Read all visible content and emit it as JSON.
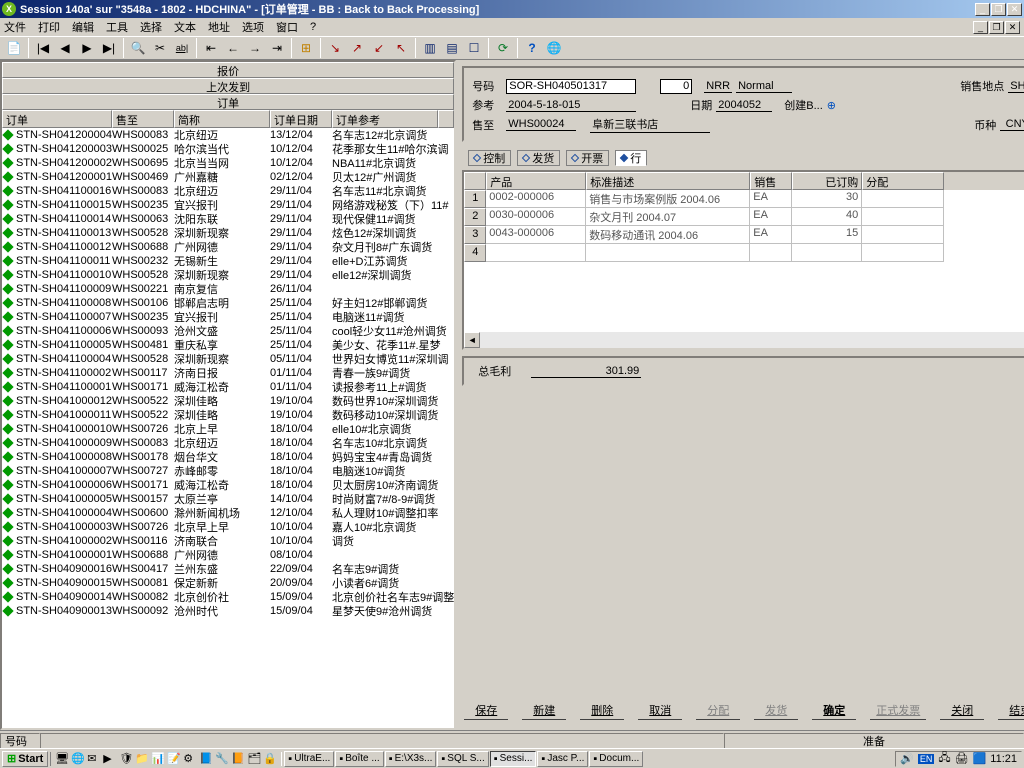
{
  "title": "Session 140a' sur \"3548a - 1802 - HDCHINA\" - [订单管理 - BB : Back to Back Processing]",
  "menu": [
    "文件",
    "打印",
    "编辑",
    "工具",
    "选择",
    "文本",
    "地址",
    "选项",
    "窗口",
    "?"
  ],
  "left_headers": {
    "h1": "报价",
    "h2": "上次发到",
    "h3": "订单"
  },
  "cols": {
    "c0": "订单",
    "c1": "售至",
    "c2": "简称",
    "c3": "订单日期",
    "c4": "订单参考"
  },
  "rows": [
    {
      "o": "STN-SH041200004",
      "w": "WHS00083",
      "n": "北京纽迈",
      "d": "13/12/04",
      "r": "名车志12#北京调货"
    },
    {
      "o": "STN-SH041200003",
      "w": "WHS00025",
      "n": "哈尔滨当代",
      "d": "10/12/04",
      "r": "花季那女生11#哈尔滨调"
    },
    {
      "o": "STN-SH041200002",
      "w": "WHS00695",
      "n": "北京当当网",
      "d": "10/12/04",
      "r": "NBA11#北京调货"
    },
    {
      "o": "STN-SH041200001",
      "w": "WHS00469",
      "n": "广州嘉糖",
      "d": "02/12/04",
      "r": "贝太12#广州调货"
    },
    {
      "o": "STN-SH041100016",
      "w": "WHS00083",
      "n": "北京纽迈",
      "d": "29/11/04",
      "r": "名车志11#北京调货"
    },
    {
      "o": "STN-SH041100015",
      "w": "WHS00235",
      "n": "宜兴报刊",
      "d": "29/11/04",
      "r": "网络游戏秘笈（下）11#"
    },
    {
      "o": "STN-SH041100014",
      "w": "WHS00063",
      "n": "沈阳东联",
      "d": "29/11/04",
      "r": "现代保健11#调货"
    },
    {
      "o": "STN-SH041100013",
      "w": "WHS00528",
      "n": "深圳新现察",
      "d": "29/11/04",
      "r": "炫色12#深圳调货"
    },
    {
      "o": "STN-SH041100012",
      "w": "WHS00688",
      "n": "广州网德",
      "d": "29/11/04",
      "r": "杂文月刊8#广东调货"
    },
    {
      "o": "STN-SH041100011",
      "w": "WHS00232",
      "n": "无锡新生",
      "d": "29/11/04",
      "r": "elle+D江苏调货"
    },
    {
      "o": "STN-SH041100010",
      "w": "WHS00528",
      "n": "深圳新现察",
      "d": "29/11/04",
      "r": "elle12#深圳调货"
    },
    {
      "o": "STN-SH041100009",
      "w": "WHS00221",
      "n": "南京复信",
      "d": "26/11/04",
      "r": ""
    },
    {
      "o": "STN-SH041100008",
      "w": "WHS00106",
      "n": "邯郸启志明",
      "d": "25/11/04",
      "r": "好主妇12#邯郸调货"
    },
    {
      "o": "STN-SH041100007",
      "w": "WHS00235",
      "n": "宜兴报刊",
      "d": "25/11/04",
      "r": "电脑迷11#调货"
    },
    {
      "o": "STN-SH041100006",
      "w": "WHS00093",
      "n": "沧州文盛",
      "d": "25/11/04",
      "r": "cool轻少女11#沧州调货"
    },
    {
      "o": "STN-SH041100005",
      "w": "WHS00481",
      "n": "重庆私享",
      "d": "25/11/04",
      "r": "美少女、花季11#.星梦"
    },
    {
      "o": "STN-SH041100004",
      "w": "WHS00528",
      "n": "深圳新现察",
      "d": "05/11/04",
      "r": "世界妇女博览11#深圳调"
    },
    {
      "o": "STN-SH041100002",
      "w": "WHS00117",
      "n": "济南日报",
      "d": "01/11/04",
      "r": "青春一族9#调货"
    },
    {
      "o": "STN-SH041100001",
      "w": "WHS00171",
      "n": "威海江松奇",
      "d": "01/11/04",
      "r": "读报参考11上#调货"
    },
    {
      "o": "STN-SH041000012",
      "w": "WHS00522",
      "n": "深圳佳略",
      "d": "19/10/04",
      "r": "数码世界10#深圳调货"
    },
    {
      "o": "STN-SH041000011",
      "w": "WHS00522",
      "n": "深圳佳略",
      "d": "19/10/04",
      "r": "数码移动10#深圳调货"
    },
    {
      "o": "STN-SH041000010",
      "w": "WHS00726",
      "n": "北京上早",
      "d": "18/10/04",
      "r": "elle10#北京调货"
    },
    {
      "o": "STN-SH041000009",
      "w": "WHS00083",
      "n": "北京纽迈",
      "d": "18/10/04",
      "r": "名车志10#北京调货"
    },
    {
      "o": "STN-SH041000008",
      "w": "WHS00178",
      "n": "烟台华文",
      "d": "18/10/04",
      "r": "妈妈宝宝4#青岛调货"
    },
    {
      "o": "STN-SH041000007",
      "w": "WHS00727",
      "n": "赤峰邮零",
      "d": "18/10/04",
      "r": "电脑迷10#调货"
    },
    {
      "o": "STN-SH041000006",
      "w": "WHS00171",
      "n": "威海江松奇",
      "d": "18/10/04",
      "r": "贝太厨房10#济南调货"
    },
    {
      "o": "STN-SH041000005",
      "w": "WHS00157",
      "n": "太原兰亭",
      "d": "14/10/04",
      "r": "时尚财富7#/8-9#调货"
    },
    {
      "o": "STN-SH041000004",
      "w": "WHS00600",
      "n": "滁州新闻机场",
      "d": "12/10/04",
      "r": "私人理财10#调整扣率"
    },
    {
      "o": "STN-SH041000003",
      "w": "WHS00726",
      "n": "北京早上早",
      "d": "10/10/04",
      "r": "嘉人10#北京调货"
    },
    {
      "o": "STN-SH041000002",
      "w": "WHS00116",
      "n": "济南联合",
      "d": "10/10/04",
      "r": "调货"
    },
    {
      "o": "STN-SH041000001",
      "w": "WHS00688",
      "n": "广州网德",
      "d": "08/10/04",
      "r": ""
    },
    {
      "o": "STN-SH040900016",
      "w": "WHS00417",
      "n": "兰州东盛",
      "d": "22/09/04",
      "r": "名车志9#调货"
    },
    {
      "o": "STN-SH040900015",
      "w": "WHS00081",
      "n": "保定新新",
      "d": "20/09/04",
      "r": "小读者6#调货"
    },
    {
      "o": "STN-SH040900014",
      "w": "WHS00082",
      "n": "北京创价社",
      "d": "15/09/04",
      "r": "北京创价社名车志9#调整"
    },
    {
      "o": "STN-SH040900013",
      "w": "WHS00092",
      "n": "沧州时代",
      "d": "15/09/04",
      "r": "星梦天使9#沧州调货"
    }
  ],
  "form": {
    "l_code": "号码",
    "code": "SOR-SH040501317",
    "zero": "0",
    "nrr": "NRR",
    "normal": "Normal",
    "l_site": "销售地点",
    "site": "SHA",
    "l_ref": "参考",
    "ref": "2004-5-18-015",
    "l_date": "日期",
    "date": "2004052",
    "l_create": "创建B...",
    "create_ico": "⊕",
    "l_sold": "售至",
    "sold": "WHS00024",
    "sold_name": "阜新三联书店",
    "l_curr": "币种",
    "curr": "CNY"
  },
  "tabs": {
    "t1": "控制",
    "t2": "发货",
    "t3": "开票",
    "t4": "行"
  },
  "grid_cols": {
    "g1": "产品",
    "g2": "标准描述",
    "g3": "销售",
    "g4": "已订购",
    "g5": "分配"
  },
  "grid": [
    {
      "n": "1",
      "p": "0002-000006",
      "d": "销售与市场案例版 2004.06",
      "u": "EA",
      "q": "30"
    },
    {
      "n": "2",
      "p": "0030-000006",
      "d": "杂文月刊 2004.07",
      "u": "EA",
      "q": "40"
    },
    {
      "n": "3",
      "p": "0043-000006",
      "d": "数码移动通讯 2004.06",
      "u": "EA",
      "q": "15"
    },
    {
      "n": "4",
      "p": "",
      "d": "",
      "u": "",
      "q": ""
    }
  ],
  "total": {
    "label": "总毛利",
    "value": "301.99"
  },
  "buttons": {
    "b1": "保存",
    "b2": "新建",
    "b3": "删除",
    "b4": "取消",
    "b5": "分配",
    "b6": "发货",
    "b7": "确定",
    "b8": "正式发票",
    "b9": "关闭",
    "b10": "结束"
  },
  "status": {
    "l": "号码",
    "r": "准备"
  },
  "taskbar": {
    "start": "Start",
    "tasks": [
      {
        "t": "UltraE..."
      },
      {
        "t": "Boîte ..."
      },
      {
        "t": "E:\\X3s..."
      },
      {
        "t": "SQL S..."
      },
      {
        "t": "Sessi...",
        "a": true
      },
      {
        "t": "Jasc P..."
      },
      {
        "t": "Docum..."
      }
    ],
    "clock": "11:21",
    "lang": "EN"
  }
}
